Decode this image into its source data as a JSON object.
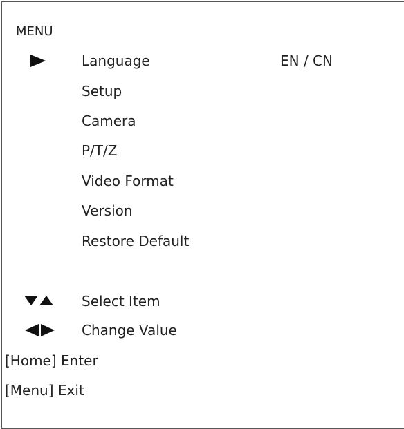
{
  "menu": {
    "title": "MENU",
    "items": [
      {
        "label": "Language",
        "value": "EN / CN",
        "selected": true
      },
      {
        "label": "Setup"
      },
      {
        "label": "Camera"
      },
      {
        "label": "P/T/Z"
      },
      {
        "label": "Video Format"
      },
      {
        "label": "Version"
      },
      {
        "label": "Restore Default"
      }
    ]
  },
  "help": {
    "select": {
      "icon": "down-up-triangles-icon",
      "label": "Select Item"
    },
    "change": {
      "icon": "left-right-triangles-icon",
      "label": "Change Value"
    },
    "enter": "[Home] Enter",
    "exit": "[Menu] Exit"
  },
  "colors": {
    "text": "#222222",
    "icon": "#111111",
    "border": "#555555",
    "background": "#ffffff"
  }
}
